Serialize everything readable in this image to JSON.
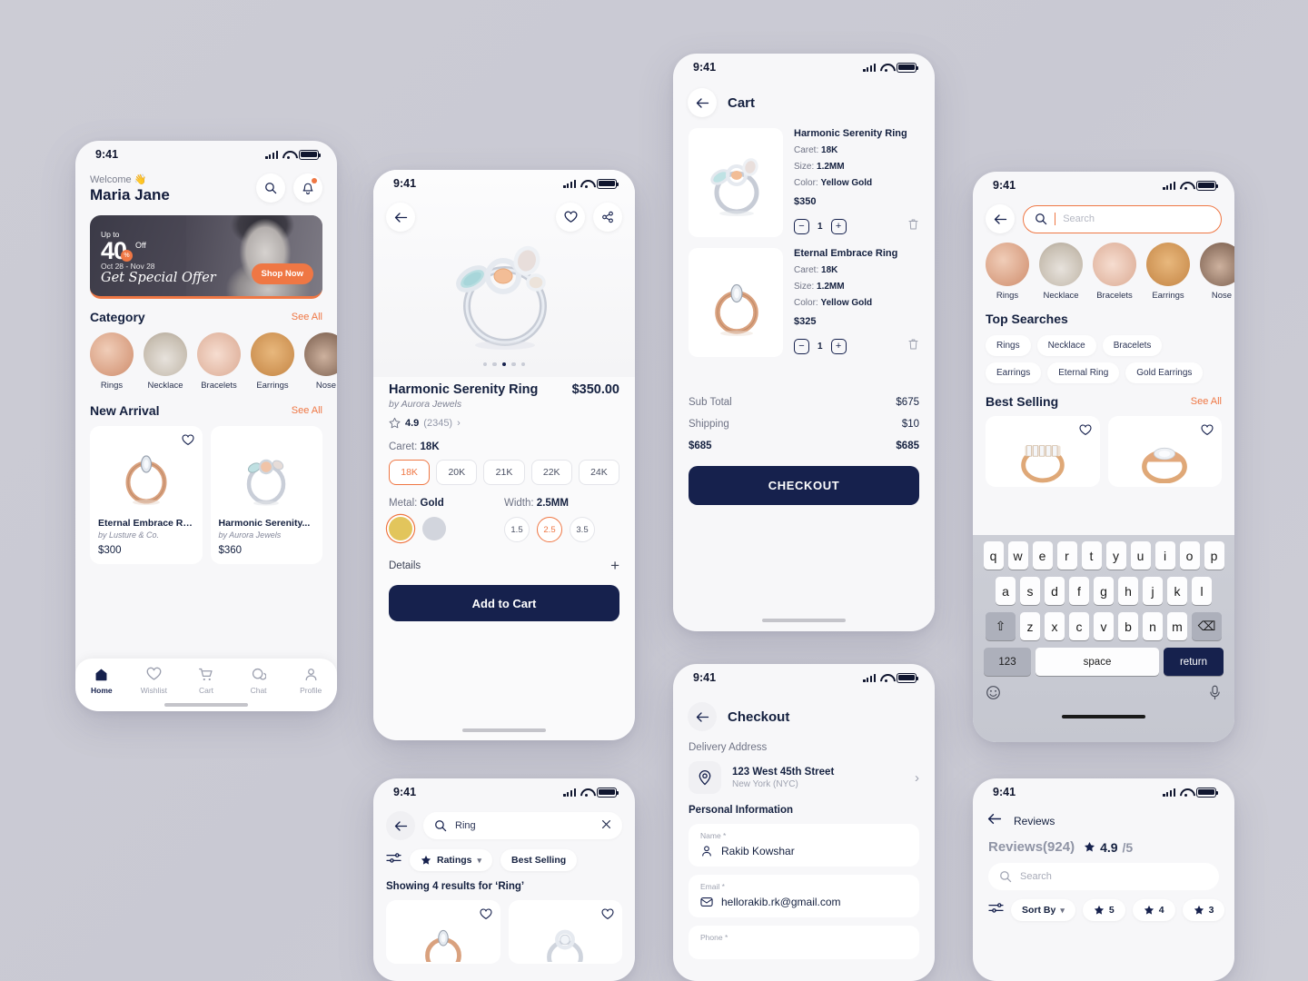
{
  "status_bar": {
    "time": "9:41"
  },
  "home": {
    "welcome": "Welcome 👋",
    "user_name": "Maria Jane",
    "search_icon": "search-icon",
    "bell_icon": "notification-bell-icon",
    "banner": {
      "up_to": "Up to",
      "percent": "40",
      "pct_sym": "%",
      "off": "Off",
      "dates": "Oct 28 - Nov 28",
      "headline": "Get Special Offer",
      "cta": "Shop Now"
    },
    "category": {
      "title": "Category",
      "see_all": "See All",
      "items": [
        {
          "label": "Rings"
        },
        {
          "label": "Necklace"
        },
        {
          "label": "Bracelets"
        },
        {
          "label": "Earrings"
        },
        {
          "label": "Nose"
        }
      ]
    },
    "new_arrival": {
      "title": "New Arrival",
      "see_all": "See All",
      "products": [
        {
          "name": "Eternal Embrace Ring",
          "by": "by Lusture & Co.",
          "price": "$300"
        },
        {
          "name": "Harmonic Serenity...",
          "by": "by Aurora Jewels",
          "price": "$360"
        }
      ]
    },
    "tabs": [
      {
        "label": "Home",
        "icon": "home-icon",
        "active": true
      },
      {
        "label": "Wishlist",
        "icon": "heart-icon",
        "active": false
      },
      {
        "label": "Cart",
        "icon": "cart-icon",
        "active": false
      },
      {
        "label": "Chat",
        "icon": "chat-icon",
        "active": false
      },
      {
        "label": "Profile",
        "icon": "profile-icon",
        "active": false
      }
    ]
  },
  "detail": {
    "back_icon": "back-arrow-icon",
    "wishlist_icon": "heart-icon",
    "share_icon": "share-icon",
    "title": "Harmonic Serenity Ring",
    "price": "$350.00",
    "by": "by Aurora Jewels",
    "rating": "4.9",
    "rating_count": "(2345)",
    "caret_label": "Caret:",
    "caret_value": "18K",
    "caret_options": [
      "18K",
      "20K",
      "21K",
      "22K",
      "24K"
    ],
    "caret_selected": "18K",
    "metal_label": "Metal:",
    "metal_value": "Gold",
    "width_label": "Width:",
    "width_value": "2.5MM",
    "width_options": [
      "1.5",
      "2.5",
      "3.5"
    ],
    "width_selected": "2.5",
    "details_label": "Details",
    "details_toggle": "+",
    "add_to_cart": "Add to Cart",
    "carousel_dots": 5,
    "carousel_active": 2
  },
  "cart": {
    "title": "Cart",
    "items": [
      {
        "name": "Harmonic Serenity Ring",
        "caret_label": "Caret:",
        "caret": "18K",
        "size_label": "Size:",
        "size": "1.2MM",
        "color_label": "Color:",
        "color": "Yellow Gold",
        "price": "$350",
        "qty": "1"
      },
      {
        "name": "Eternal Embrace Ring",
        "caret_label": "Caret:",
        "caret": "18K",
        "size_label": "Size:",
        "size": "1.2MM",
        "color_label": "Color:",
        "color": "Yellow Gold",
        "price": "$325",
        "qty": "1"
      }
    ],
    "summary": [
      {
        "label": "Sub Total",
        "value": "$675",
        "bold": false
      },
      {
        "label": "Shipping",
        "value": "$10",
        "bold": false
      },
      {
        "label": "$685",
        "value": "$685",
        "bold": true
      }
    ],
    "checkout_button": "CHECKOUT"
  },
  "search": {
    "placeholder": "Search",
    "categories": [
      {
        "label": "Rings"
      },
      {
        "label": "Necklace"
      },
      {
        "label": "Bracelets"
      },
      {
        "label": "Earrings"
      },
      {
        "label": "Nose"
      }
    ],
    "top_searches_title": "Top Searches",
    "top_searches": [
      "Rings",
      "Necklace",
      "Bracelets",
      "Earrings",
      "Eternal Ring",
      "Gold Earrings"
    ],
    "best_selling_title": "Best Selling",
    "best_selling_see_all": "See All",
    "keyboard": {
      "row1": [
        "q",
        "w",
        "e",
        "r",
        "t",
        "y",
        "u",
        "i",
        "o",
        "p"
      ],
      "row2": [
        "a",
        "s",
        "d",
        "f",
        "g",
        "h",
        "j",
        "k",
        "l"
      ],
      "row3": [
        "z",
        "x",
        "c",
        "v",
        "b",
        "n",
        "m"
      ],
      "shift": "⇧",
      "backspace": "⌫",
      "numbers": "123",
      "space": "space",
      "return": "return",
      "emoji": "emoji-icon",
      "mic": "microphone-icon"
    }
  },
  "checkout": {
    "title": "Checkout",
    "delivery_address_title": "Delivery Address",
    "address_line1": "123 West 45th Street",
    "address_line2": "New York (NYC)",
    "personal_info_title": "Personal Information",
    "fields": [
      {
        "label": "Name *",
        "value": "Rakib Kowshar",
        "icon": "person-icon"
      },
      {
        "label": "Email *",
        "value": "hellorakib.rk@gmail.com",
        "icon": "envelope-icon"
      },
      {
        "label": "Phone *",
        "value": "",
        "icon": "phone-icon"
      }
    ]
  },
  "results": {
    "query": "Ring",
    "clear_icon": "close-icon",
    "filter_icon": "filter-icon",
    "chips": [
      {
        "label": "Ratings",
        "star": true,
        "chevron": true
      },
      {
        "label": "Best Selling",
        "star": false,
        "chevron": false
      }
    ],
    "showing": "Showing 4 results for ‘Ring’"
  },
  "reviews": {
    "header_title": "Reviews",
    "count_label": "Reviews",
    "count_value": "(924)",
    "score": "4.9",
    "score_out_of": "/5",
    "search_placeholder": "Search",
    "filter_icon": "filter-icon",
    "sort_by": "Sort By",
    "star_filters": [
      "5",
      "4",
      "3"
    ]
  },
  "colors": {
    "accent_orange": "#ef7744",
    "navy": "#16214d",
    "background": "#cbcbd4",
    "card_white": "#ffffff"
  }
}
